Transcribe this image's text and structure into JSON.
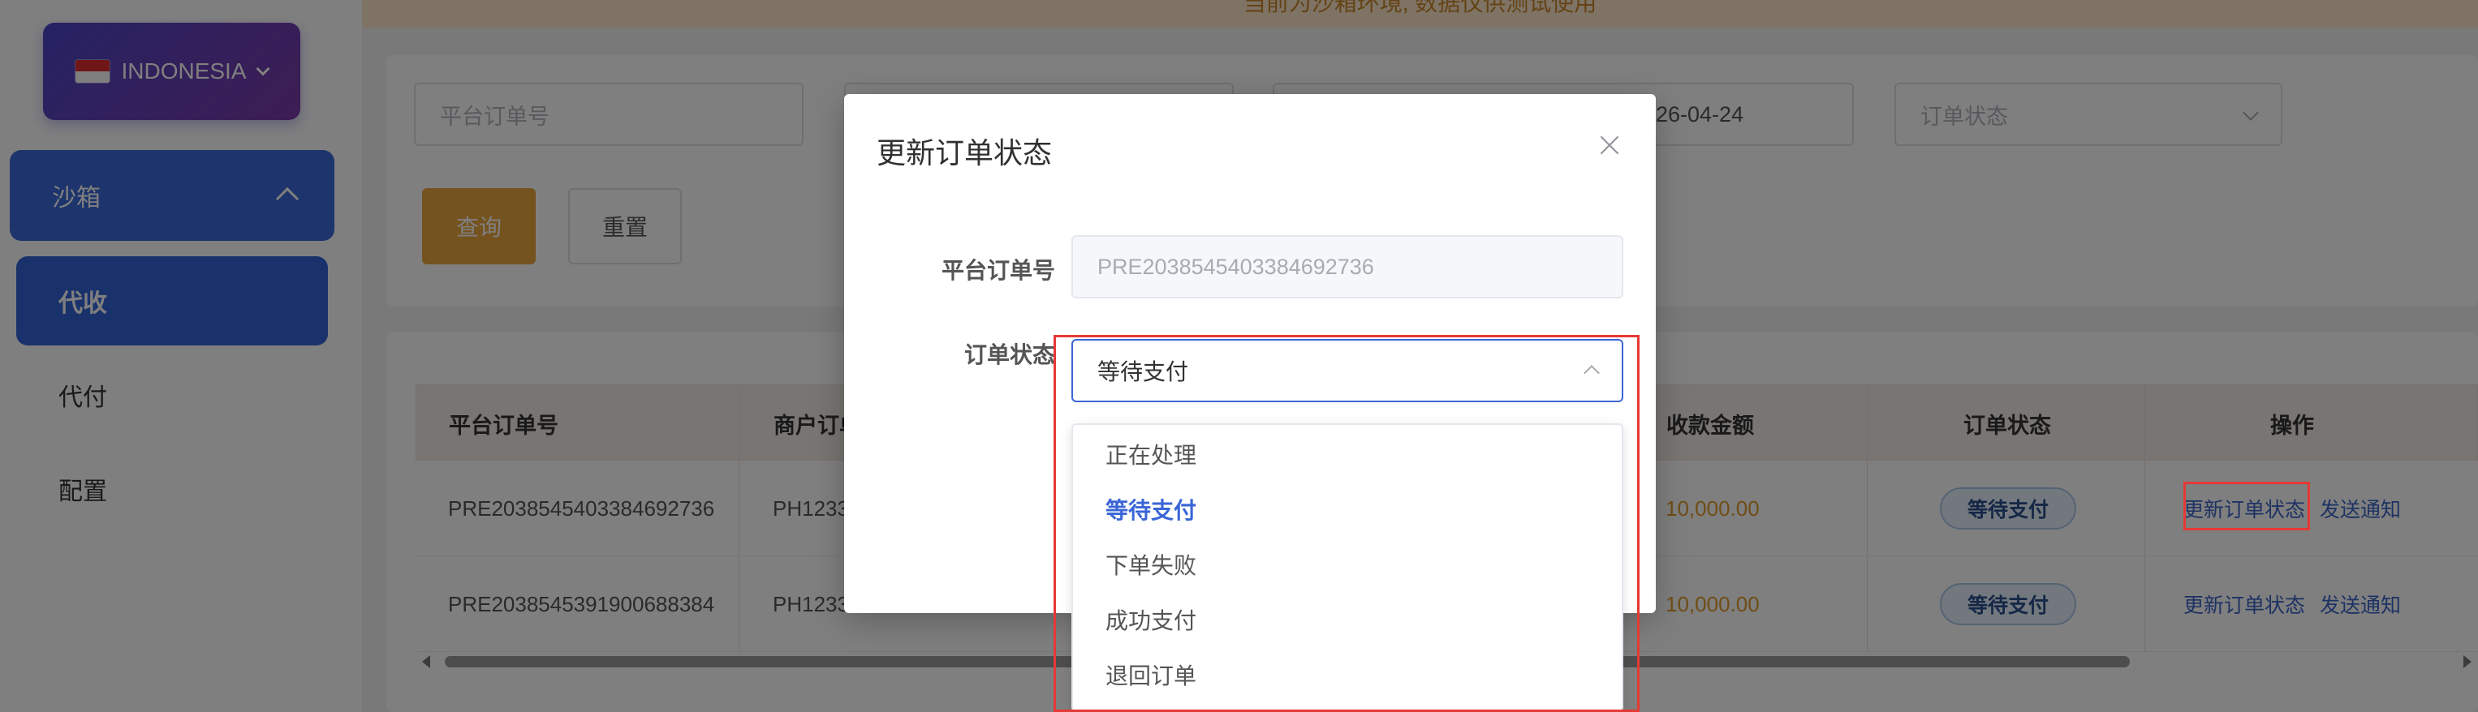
{
  "sidebar": {
    "country": "INDONESIA",
    "menu_group": "沙箱",
    "items": [
      {
        "label": "代收",
        "active": true
      },
      {
        "label": "代付",
        "active": false
      },
      {
        "label": "配置",
        "active": false
      }
    ]
  },
  "notice": {
    "text": "当前为沙箱环境, 数据仅供测试使用"
  },
  "filters": {
    "platform_order_placeholder": "平台订单号",
    "date_end_value": "26-04-24",
    "status_placeholder": "订单状态",
    "query_label": "查询",
    "reset_label": "重置"
  },
  "table": {
    "columns": [
      "平台订单号",
      "商户订单",
      "收款金额",
      "订单状态",
      "操作"
    ],
    "rows": [
      {
        "platform_order": "PRE2038545403384692736",
        "merchant_order": "PH1233",
        "amount": "10,000.00",
        "status": "等待支付",
        "actions": [
          "更新订单状态",
          "发送通知"
        ]
      },
      {
        "platform_order": "PRE2038545391900688384",
        "merchant_order": "PH1233",
        "amount": "10,000.00",
        "status": "等待支付",
        "actions": [
          "更新订单状态",
          "发送通知"
        ]
      }
    ]
  },
  "modal": {
    "title": "更新订单状态",
    "platform_order_label": "平台订单号",
    "platform_order_value": "PRE2038545403384692736",
    "status_label": "订单状态",
    "status_value": "等待支付",
    "options": [
      {
        "label": "正在处理",
        "selected": false
      },
      {
        "label": "等待支付",
        "selected": true
      },
      {
        "label": "下单失败",
        "selected": false
      },
      {
        "label": "成功支付",
        "selected": false
      },
      {
        "label": "退回订单",
        "selected": false
      }
    ]
  },
  "colors": {
    "primary_blue": "#3464d6",
    "query_orange": "#eaa73f",
    "amount_orange": "#e09a2a",
    "highlight_red": "#e53935"
  }
}
